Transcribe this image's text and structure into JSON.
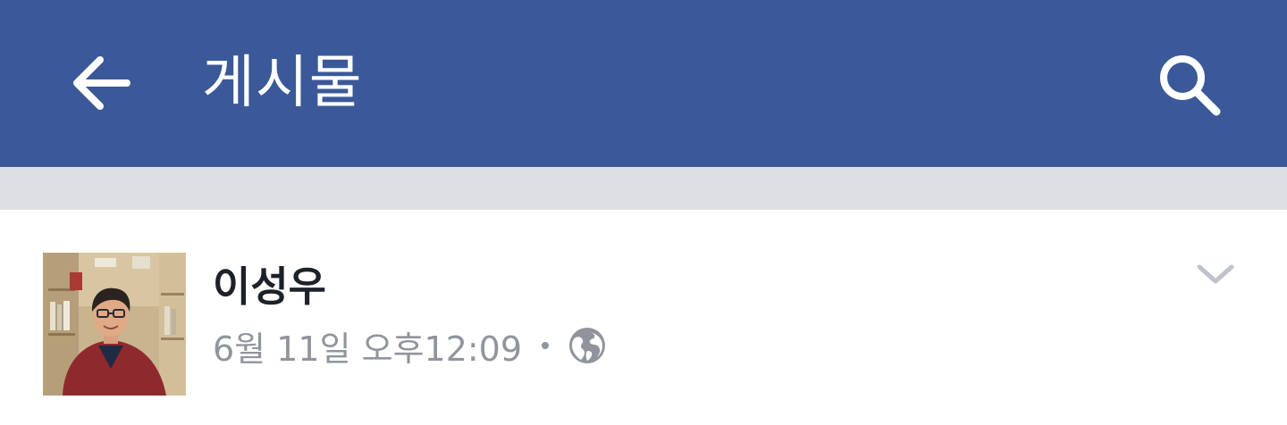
{
  "header": {
    "title": "게시물",
    "back_icon": "arrow-left-icon",
    "search_icon": "search-icon",
    "background_color": "#3b5998"
  },
  "post": {
    "author": "이성우",
    "timestamp": "6월 11일 오후12:09",
    "privacy_icon": "globe-icon",
    "menu_icon": "chevron-down-icon",
    "avatar": "profile-photo"
  }
}
